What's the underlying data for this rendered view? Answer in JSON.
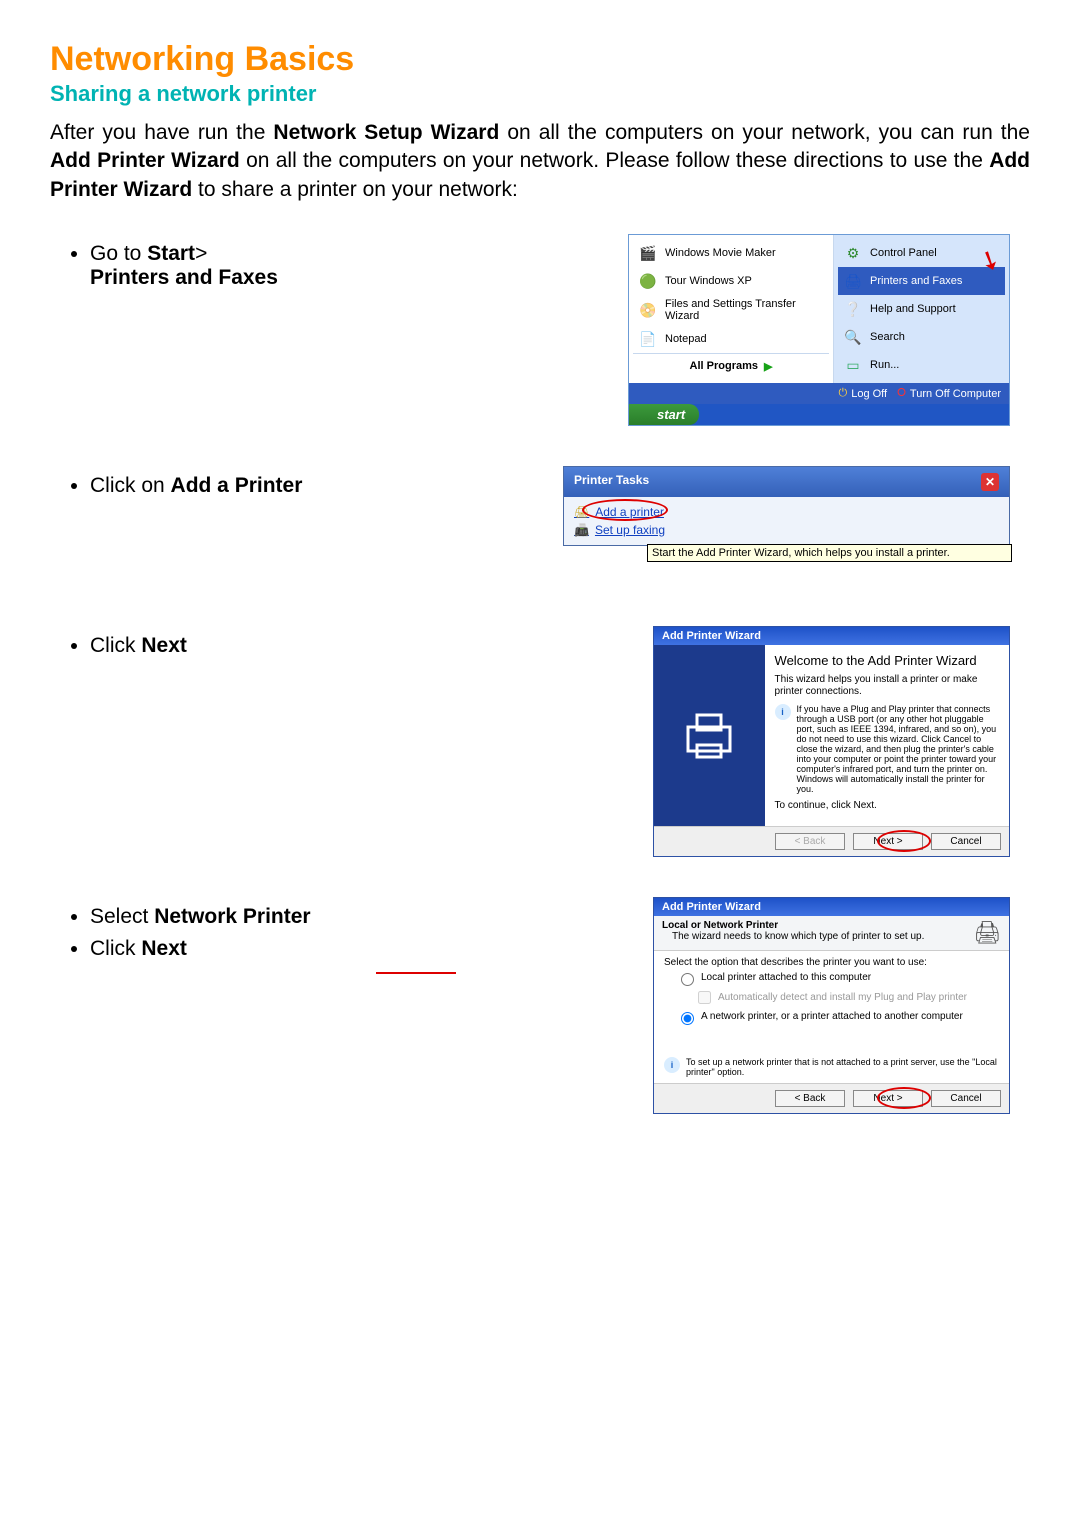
{
  "title": "Networking Basics",
  "subtitle": "Sharing a network printer",
  "intro_parts": {
    "p1": "After you have run the ",
    "b1": "Network Setup Wizard",
    "p2": " on all the computers on your network, you can run the ",
    "b2": "Add Printer Wizard",
    "p3": " on all the computers on your network.  Please follow these directions to use the ",
    "b3": "Add Printer Wizard",
    "p4": " to share a printer on your network:"
  },
  "step1": {
    "pre": "Go to ",
    "bold1": "Start",
    "post1": "> ",
    "bold2": "Printers and Faxes"
  },
  "step2": {
    "pre": "Click on ",
    "bold": "Add a Printer"
  },
  "step3": {
    "pre": "Click ",
    "bold": "Next"
  },
  "step4": {
    "pre": "Select ",
    "bold": "Network Printer"
  },
  "step5": {
    "pre": "Click ",
    "bold": "Next"
  },
  "startmenu": {
    "left_items": [
      {
        "label": "Windows Movie Maker"
      },
      {
        "label": "Tour Windows XP"
      },
      {
        "label": "Files and Settings Transfer Wizard"
      },
      {
        "label": "Notepad"
      }
    ],
    "right_items": [
      {
        "label": "Control Panel"
      },
      {
        "label": "Printers and Faxes",
        "highlight": true
      },
      {
        "label": "Help and Support"
      },
      {
        "label": "Search"
      },
      {
        "label": "Run..."
      }
    ],
    "all_programs": "All Programs",
    "log_off": "Log Off",
    "turn_off": "Turn Off Computer",
    "start": "start"
  },
  "printer_tasks": {
    "title": "Printer Tasks",
    "add": "Add a printer",
    "fax": "Set up faxing",
    "tooltip": "Start the Add Printer Wizard, which helps you install a printer."
  },
  "wizard1": {
    "title": "Add Printer Wizard",
    "welcome": "Welcome to the Add Printer Wizard",
    "desc": "This wizard helps you install a printer or make printer connections.",
    "info": "If you have a Plug and Play printer that connects through a USB port (or any other hot pluggable port, such as IEEE 1394, infrared, and so on), you do not need to use this wizard. Click Cancel to close the wizard, and then plug the printer's cable into your computer or point the printer toward your computer's infrared port, and turn the printer on. Windows will automatically install the printer for you.",
    "continue": "To continue, click Next.",
    "back": "< Back",
    "next": "Next >",
    "cancel": "Cancel"
  },
  "wizard2": {
    "title": "Add Printer Wizard",
    "header": "Local or Network Printer",
    "subheader": "The wizard needs to know which type of printer to set up.",
    "prompt": "Select the option that describes the printer you want to use:",
    "opt_local": "Local printer attached to this computer",
    "opt_auto": "Automatically detect and install my Plug and Play printer",
    "opt_net": "A network printer, or a printer attached to another computer",
    "info": "To set up a network printer that is not attached to a print server, use the \"Local printer\" option.",
    "back": "< Back",
    "next": "Next >",
    "cancel": "Cancel"
  }
}
